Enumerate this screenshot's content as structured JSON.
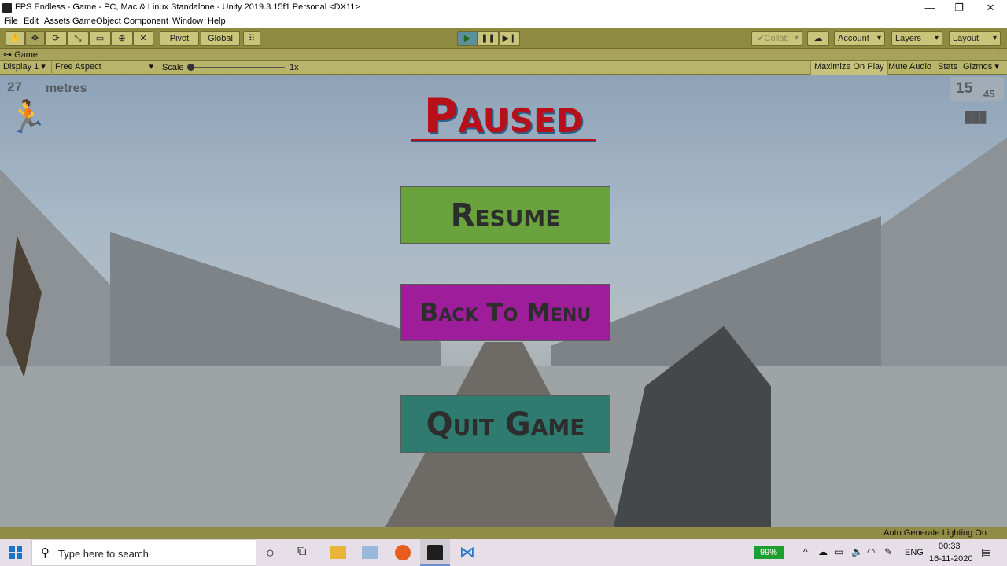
{
  "window": {
    "title": "FPS Endless - Game - PC, Mac & Linux Standalone - Unity 2019.3.15f1 Personal <DX11>"
  },
  "menu": [
    "File",
    "Edit",
    "Assets",
    "GameObject",
    "Component",
    "Window",
    "Help"
  ],
  "toolbar": {
    "pivot": "Pivot",
    "global": "Global",
    "collab": "Collab",
    "account": "Account",
    "layers": "Layers",
    "layout": "Layout"
  },
  "game_tab": {
    "label": "Game"
  },
  "game_controls": {
    "display": "Display 1",
    "aspect": "Free Aspect",
    "scale_label": "Scale",
    "scale_value": "1x",
    "maximize": "Maximize On Play",
    "mute": "Mute Audio",
    "stats": "Stats",
    "gizmos": "Gizmos"
  },
  "hud": {
    "distance": "27",
    "distance_unit": "metres",
    "ammo_clip": "15",
    "ammo_total": "45"
  },
  "pause_menu": {
    "title": "Paused",
    "resume": "Resume",
    "back_to_menu": "Back To Menu",
    "quit": "Quit Game"
  },
  "colors": {
    "resume_bg": "#6aa23e",
    "back_bg": "#9d1d9a",
    "quit_bg": "#2f7b70",
    "title_red": "#b8101a"
  },
  "status_bar": {
    "text": "Auto Generate Lighting On"
  },
  "taskbar": {
    "search_placeholder": "Type here to search",
    "battery": "99%",
    "language": "ENG",
    "time": "00:33",
    "date": "16-11-2020"
  }
}
